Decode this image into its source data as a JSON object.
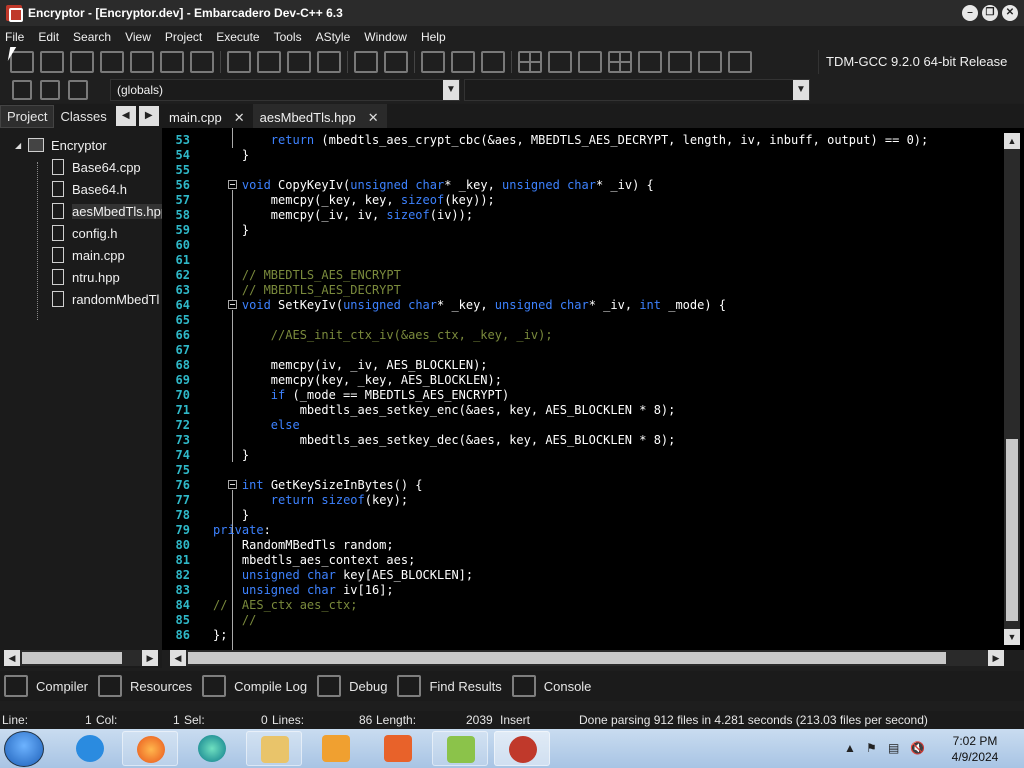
{
  "window": {
    "title": "Encryptor - [Encryptor.dev] - Embarcadero Dev-C++ 6.3"
  },
  "menu": [
    "File",
    "Edit",
    "Search",
    "View",
    "Project",
    "Execute",
    "Tools",
    "AStyle",
    "Window",
    "Help"
  ],
  "compiler": "TDM-GCC 9.2.0 64-bit Release",
  "scope_combo": "(globals)",
  "sidebar": {
    "tabs": [
      "Project",
      "Classes"
    ],
    "root": "Encryptor",
    "files": [
      "Base64.cpp",
      "Base64.h",
      "aesMbedTls.hpp",
      "config.h",
      "main.cpp",
      "ntru.hpp",
      "randomMbedTl"
    ],
    "selected": "aesMbedTls.hpp"
  },
  "editor": {
    "tabs": [
      {
        "label": "main.cpp",
        "close": "✕"
      },
      {
        "label": "aesMbedTls.hpp",
        "close": "✕"
      }
    ],
    "active_tab": "aesMbedTls.hpp",
    "lines": [
      {
        "n": "53",
        "t": "        return (mbedtls_aes_crypt_cbc(&aes, MBEDTLS_AES_DECRYPT, length, iv, inbuff, output) == 0);"
      },
      {
        "n": "54",
        "t": "    }"
      },
      {
        "n": "55",
        "t": ""
      },
      {
        "n": "56",
        "t": "    void CopyKeyIv(unsigned char* _key, unsigned char* _iv) {"
      },
      {
        "n": "57",
        "t": "        memcpy(_key, key, sizeof(key));"
      },
      {
        "n": "58",
        "t": "        memcpy(_iv, iv, sizeof(iv));"
      },
      {
        "n": "59",
        "t": "    }"
      },
      {
        "n": "60",
        "t": ""
      },
      {
        "n": "61",
        "t": ""
      },
      {
        "n": "62",
        "t": "    // MBEDTLS_AES_ENCRYPT"
      },
      {
        "n": "63",
        "t": "    // MBEDTLS_AES_DECRYPT"
      },
      {
        "n": "64",
        "t": "    void SetKeyIv(unsigned char* _key, unsigned char* _iv, int _mode) {"
      },
      {
        "n": "65",
        "t": ""
      },
      {
        "n": "66",
        "t": "        //AES_init_ctx_iv(&aes_ctx, _key, _iv);"
      },
      {
        "n": "67",
        "t": ""
      },
      {
        "n": "68",
        "t": "        memcpy(iv, _iv, AES_BLOCKLEN);"
      },
      {
        "n": "69",
        "t": "        memcpy(key, _key, AES_BLOCKLEN);"
      },
      {
        "n": "70",
        "t": "        if (_mode == MBEDTLS_AES_ENCRYPT)"
      },
      {
        "n": "71",
        "t": "            mbedtls_aes_setkey_enc(&aes, key, AES_BLOCKLEN * 8);"
      },
      {
        "n": "72",
        "t": "        else"
      },
      {
        "n": "73",
        "t": "            mbedtls_aes_setkey_dec(&aes, key, AES_BLOCKLEN * 8);"
      },
      {
        "n": "74",
        "t": "    }"
      },
      {
        "n": "75",
        "t": ""
      },
      {
        "n": "76",
        "t": "    int GetKeySizeInBytes() {"
      },
      {
        "n": "77",
        "t": "        return sizeof(key);"
      },
      {
        "n": "78",
        "t": "    }"
      },
      {
        "n": "79",
        "t": "private:"
      },
      {
        "n": "80",
        "t": "    RandomMBedTls random;"
      },
      {
        "n": "81",
        "t": "    mbedtls_aes_context aes;"
      },
      {
        "n": "82",
        "t": "    unsigned char key[AES_BLOCKLEN];"
      },
      {
        "n": "83",
        "t": "    unsigned char iv[16];"
      },
      {
        "n": "84",
        "t": "//  AES_ctx aes_ctx;"
      },
      {
        "n": "85",
        "t": "    //"
      },
      {
        "n": "86",
        "t": "};"
      }
    ]
  },
  "bottom_tabs": [
    "Compiler",
    "Resources",
    "Compile Log",
    "Debug",
    "Find Results",
    "Console"
  ],
  "status": {
    "line_label": "Line:",
    "line": "1",
    "col_label": "Col:",
    "col": "1",
    "sel_label": "Sel:",
    "sel": "0",
    "lines_label": "Lines:",
    "lines": "86",
    "length_label": "Length:",
    "length": "2039",
    "mode": "Insert",
    "message": "Done parsing 912 files in 4.281 seconds (213.03 files per second)"
  },
  "taskbar": {
    "time": "7:02 PM",
    "date": "4/9/2024"
  }
}
